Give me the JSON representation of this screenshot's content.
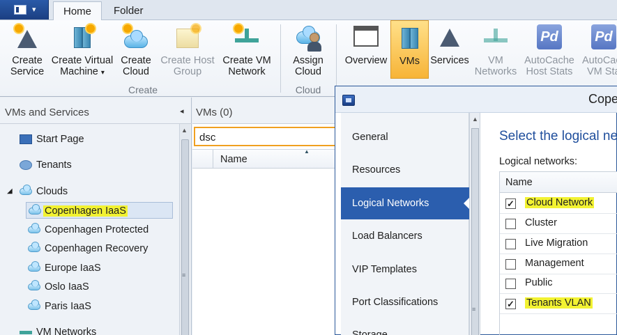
{
  "tabs": [
    {
      "label": "Home",
      "active": true
    },
    {
      "label": "Folder",
      "active": false
    }
  ],
  "ribbon": {
    "create": [
      "Create",
      "Service",
      "Create Virtual",
      "Machine",
      "Create",
      "Cloud",
      "Create Host",
      "Group",
      "Create VM",
      "Network"
    ],
    "create_group_label": "Create",
    "assign": [
      "Assign",
      "Cloud"
    ],
    "cloud_group_label": "Cloud",
    "view": [
      "Overview",
      "VMs",
      "Services",
      "VM",
      "Networks",
      "AutoCache",
      "Host Stats",
      "AutoCache",
      "VM Stats"
    ],
    "dropdown_caret": "▾",
    "pd_label": "Pd"
  },
  "leftpane": {
    "title": "VMs and Services",
    "collapse_glyph": "◂",
    "start_page": "Start Page",
    "tenants": "Tenants",
    "clouds": "Clouds",
    "cloud_items": [
      "Copenhagen IaaS",
      "Copenhagen Protected",
      "Copenhagen Recovery",
      "Europe IaaS",
      "Oslo IaaS",
      "Paris IaaS"
    ],
    "vm_networks": "VM Networks",
    "selected_index": 0
  },
  "midpane": {
    "title": "VMs (0)",
    "search_value": "dsc",
    "column_name": "Name"
  },
  "dialog": {
    "title": "Cope",
    "nav_items": [
      "General",
      "Resources",
      "Logical Networks",
      "Load Balancers",
      "VIP Templates",
      "Port Classifications",
      "Storage"
    ],
    "active_nav_index": 2,
    "heading": "Select the logical ne",
    "sublabel": "Logical networks:",
    "table_header": "Name",
    "networks": [
      {
        "name": "Cloud Network",
        "checked": true,
        "highlight": true
      },
      {
        "name": "Cluster",
        "checked": false,
        "highlight": false
      },
      {
        "name": "Live Migration",
        "checked": false,
        "highlight": false
      },
      {
        "name": "Management",
        "checked": false,
        "highlight": false
      },
      {
        "name": "Public",
        "checked": false,
        "highlight": false
      },
      {
        "name": "Tenants VLAN",
        "checked": true,
        "highlight": true
      }
    ]
  },
  "colors": {
    "accent_blue": "#2b5eae",
    "selected_orange": "#f7b437",
    "highlight_yellow": "#f2f232",
    "search_border": "#f0a020"
  }
}
